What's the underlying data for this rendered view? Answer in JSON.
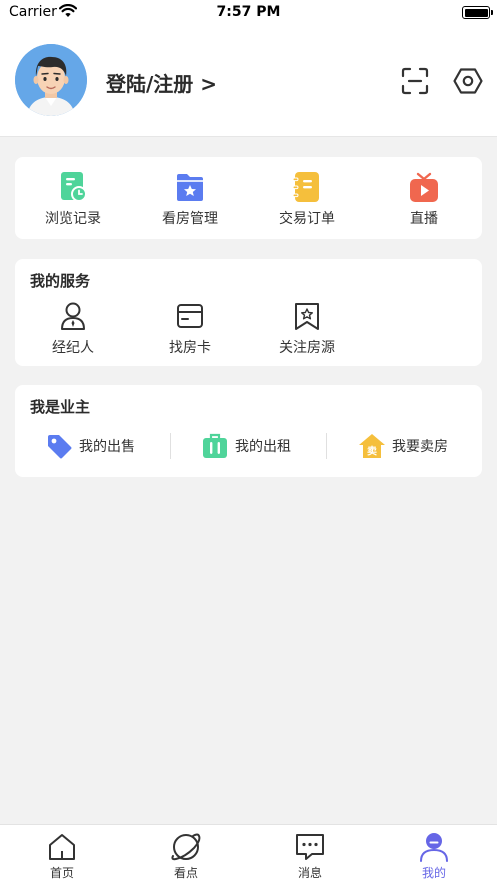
{
  "status_bar": {
    "carrier": "Carrier",
    "time": "7:57 PM"
  },
  "profile": {
    "login_label": "登陆/注册 >"
  },
  "quick_actions": [
    {
      "label": "浏览记录",
      "icon": "history-icon",
      "color": "#4fd49a"
    },
    {
      "label": "看房管理",
      "icon": "house-folder-icon",
      "color": "#5b7cf0"
    },
    {
      "label": "交易订单",
      "icon": "order-notebook-icon",
      "color": "#f5bf3c"
    },
    {
      "label": "直播",
      "icon": "live-tv-icon",
      "color": "#f0674f"
    }
  ],
  "services": {
    "title": "我的服务",
    "items": [
      {
        "label": "经纪人",
        "icon": "agent-icon"
      },
      {
        "label": "找房卡",
        "icon": "card-icon"
      },
      {
        "label": "关注房源",
        "icon": "bookmark-star-icon"
      }
    ]
  },
  "owner": {
    "title": "我是业主",
    "items": [
      {
        "label": "我的出售",
        "icon": "tag-icon",
        "color": "#5b7cf0"
      },
      {
        "label": "我的出租",
        "icon": "suitcase-icon",
        "color": "#4fd49a"
      },
      {
        "label": "我要卖房",
        "icon": "sell-house-icon",
        "color": "#f5bf3c",
        "badge": "卖"
      }
    ]
  },
  "tabs": [
    {
      "label": "首页",
      "icon": "home-icon"
    },
    {
      "label": "看点",
      "icon": "planet-icon"
    },
    {
      "label": "消息",
      "icon": "message-icon"
    },
    {
      "label": "我的",
      "icon": "profile-icon",
      "active": true
    }
  ],
  "colors": {
    "accent": "#6666e6",
    "background": "#f2f2f2"
  }
}
